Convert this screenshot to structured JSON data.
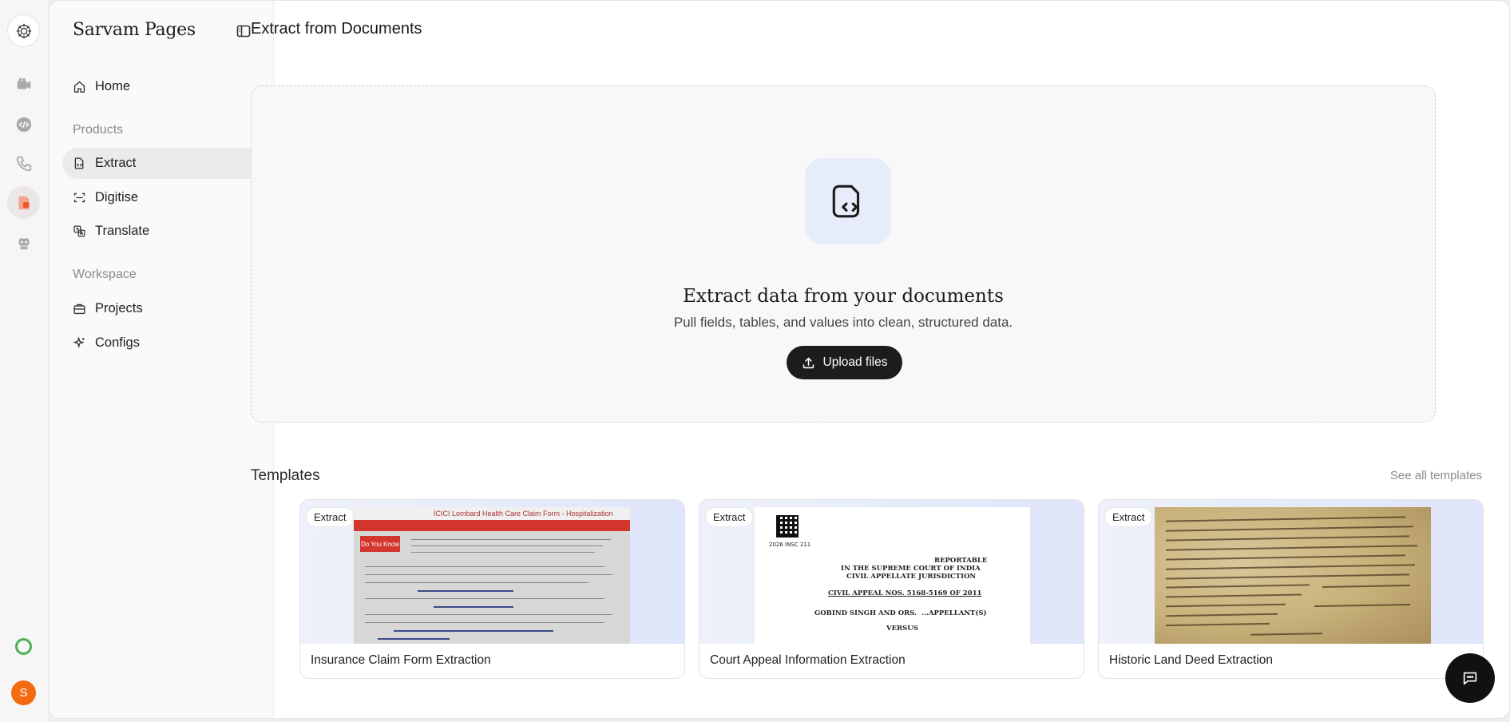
{
  "app": {
    "brand": "Sarvam Pages",
    "user_initial": "S"
  },
  "rail": {
    "icons": [
      "sarvam-logo-icon",
      "video-icon",
      "code-icon",
      "phone-icon",
      "pages-icon",
      "robot-icon"
    ],
    "active_index": 4
  },
  "sidebar": {
    "home": "Home",
    "products_heading": "Products",
    "products": [
      {
        "label": "Extract",
        "icon": "extract-icon",
        "active": true
      },
      {
        "label": "Digitise",
        "icon": "scan-icon",
        "active": false
      },
      {
        "label": "Translate",
        "icon": "translate-icon",
        "active": false
      }
    ],
    "workspace_heading": "Workspace",
    "workspace": [
      {
        "label": "Projects",
        "icon": "briefcase-icon"
      },
      {
        "label": "Configs",
        "icon": "sparkle-icon"
      }
    ]
  },
  "main": {
    "title": "Extract from Documents",
    "dropzone": {
      "heading": "Extract data from your documents",
      "subheading": "Pull fields, tables, and values into clean, structured data.",
      "upload_label": "Upload files"
    },
    "templates": {
      "title": "Templates",
      "see_all": "See all templates",
      "items": [
        {
          "badge": "Extract",
          "name": "Insurance Claim Form Extraction"
        },
        {
          "badge": "Extract",
          "name": "Court Appeal Information Extraction"
        },
        {
          "badge": "Extract",
          "name": "Historic Land Deed Extraction"
        }
      ]
    }
  },
  "thumbnails": {
    "insurance": {
      "header": "ICICI Lombard Health Care Claim Form - Hospitalization",
      "box": "Do You Know"
    },
    "court": {
      "code": "2026 INSC 211",
      "reportable": "REPORTABLE",
      "court": "IN THE SUPREME COURT OF INDIA",
      "jurisdiction": "CIVIL APPELLATE JURISDICTION",
      "appeal": "CIVIL APPEAL NOS. 5168-5169 OF 2011",
      "party": "GOBIND SINGH AND ORS.",
      "role": "...APPELLANT(S)",
      "versus": "VERSUS"
    }
  },
  "colors": {
    "accent_dark": "#1c1c1c",
    "active_nav_bg": "#ebebeb",
    "icon_tile_bg": "#e7ecfa",
    "avatar_bg": "#f36b10",
    "status_ring": "#4caf50"
  }
}
